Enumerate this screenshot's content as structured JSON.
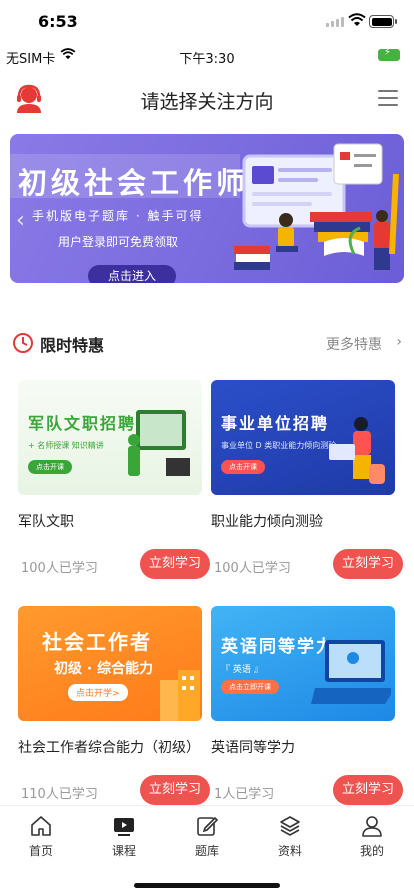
{
  "status_bar": {
    "time": "6:53"
  },
  "sub_status": {
    "carrier": "无SIM卡",
    "clock": "下午3:30"
  },
  "header": {
    "title": "请选择关注方向"
  },
  "banner": {
    "title": "初级社会工作师",
    "subtitle": "手机版电子题库 · 触手可得",
    "note": "用户登录即可免费领取",
    "button": "点击进入"
  },
  "section": {
    "title": "限时特惠",
    "more": "更多特惠"
  },
  "courses": [
    {
      "name": "军队文职",
      "count": "100人已学习",
      "button": "立刻学习",
      "thumb_title": "军队文职招聘",
      "thumb_sub": "+ 名师授课  知识精讲",
      "thumb_pill": "点击开课"
    },
    {
      "name": "职业能力倾向测验",
      "count": "100人已学习",
      "button": "立刻学习",
      "thumb_title": "事业单位招聘",
      "thumb_sub": "事业单位 D 类职业能力倾向测验",
      "thumb_pill": "点击开课"
    },
    {
      "name": "社会工作者综合能力（初级）",
      "count": "110人已学习",
      "button": "立刻学习",
      "thumb_title": "社会工作者",
      "thumb_sub": "初级 · 综合能力",
      "thumb_pill": "点击开学>"
    },
    {
      "name": "英语同等学力",
      "count": "1人已学习",
      "button": "立刻学习",
      "thumb_title": "英语同等学力",
      "thumb_sub": "『 英语 』",
      "thumb_pill": "点击立即开课"
    }
  ],
  "tabs": [
    {
      "label": "首页",
      "icon": "home-icon"
    },
    {
      "label": "课程",
      "icon": "course-icon"
    },
    {
      "label": "题库",
      "icon": "edit-icon"
    },
    {
      "label": "资料",
      "icon": "layers-icon"
    },
    {
      "label": "我的",
      "icon": "user-icon"
    }
  ]
}
